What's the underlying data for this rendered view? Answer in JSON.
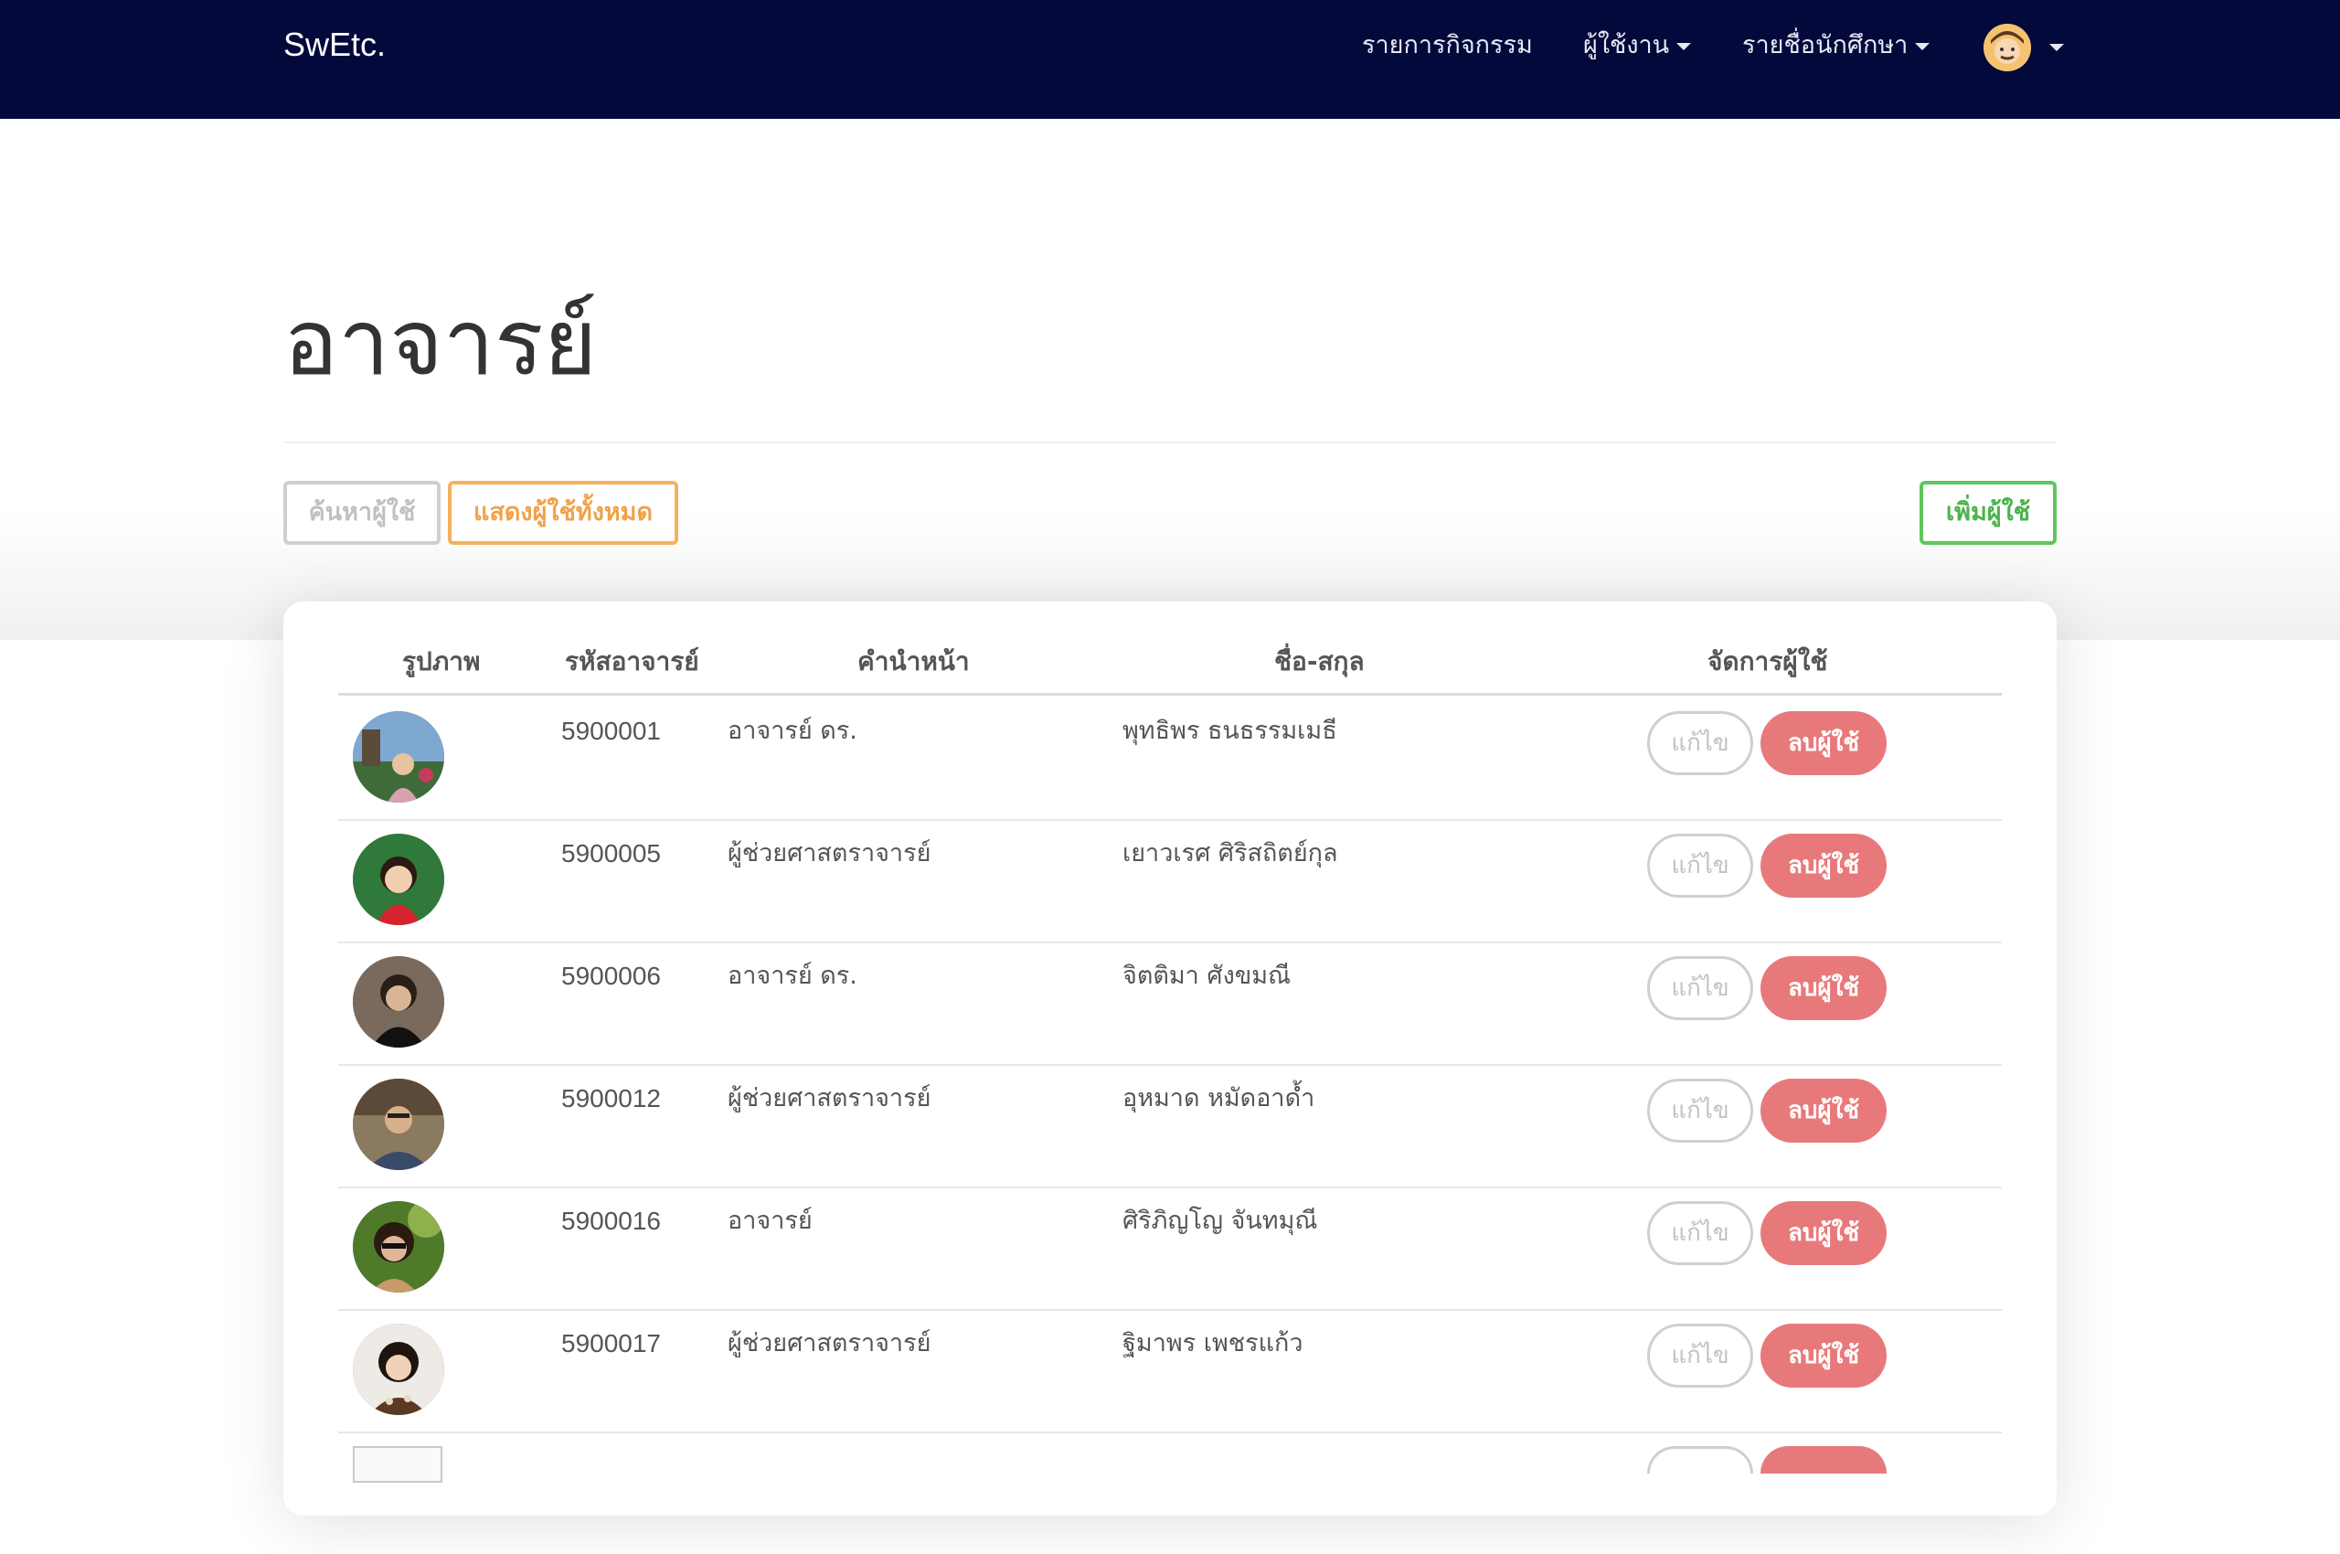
{
  "navbar": {
    "brand": "SwEtc.",
    "items": [
      {
        "label": "รายการกิจกรรม"
      },
      {
        "label": "ผู้ใช้งาน"
      },
      {
        "label": "รายชื่อนักศึกษา"
      }
    ]
  },
  "page": {
    "title": "อาจารย์"
  },
  "toolbar": {
    "search_label": "ค้นหาผู้ใช้",
    "show_all_label": "แสดงผู้ใช้ทั้งหมด",
    "add_label": "เพิ่มผู้ใช้"
  },
  "table": {
    "headers": [
      "รูปภาพ",
      "รหัสอาจารย์",
      "คำนำหน้า",
      "ชื่อ-สกุล",
      "จัดการผู้ใช้"
    ],
    "edit_label": "แก้ไข",
    "delete_label": "ลบผู้ใช้",
    "rows": [
      {
        "id": "5900001",
        "prefix": "อาจารย์ ดร.",
        "name": "พุทธิพร ธนธรรมเมธี"
      },
      {
        "id": "5900005",
        "prefix": "ผู้ช่วยศาสตราจารย์",
        "name": "เยาวเรศ ศิริสถิตย์กุล"
      },
      {
        "id": "5900006",
        "prefix": "อาจารย์ ดร.",
        "name": "จิตติมา ศังขมณี"
      },
      {
        "id": "5900012",
        "prefix": "ผู้ช่วยศาสตราจารย์",
        "name": "อุหมาด หมัดอาด้ำ"
      },
      {
        "id": "5900016",
        "prefix": "อาจารย์",
        "name": "ศิริภิญโญ จันทมุณี"
      },
      {
        "id": "5900017",
        "prefix": "ผู้ช่วยศาสตราจารย์",
        "name": "ฐิมาพร เพชรแก้ว"
      }
    ]
  },
  "colors": {
    "navbar_bg": "#03093a",
    "delete_button": "#e8797b",
    "show_all_border": "#f5b15c",
    "add_border": "#5cc75c"
  }
}
